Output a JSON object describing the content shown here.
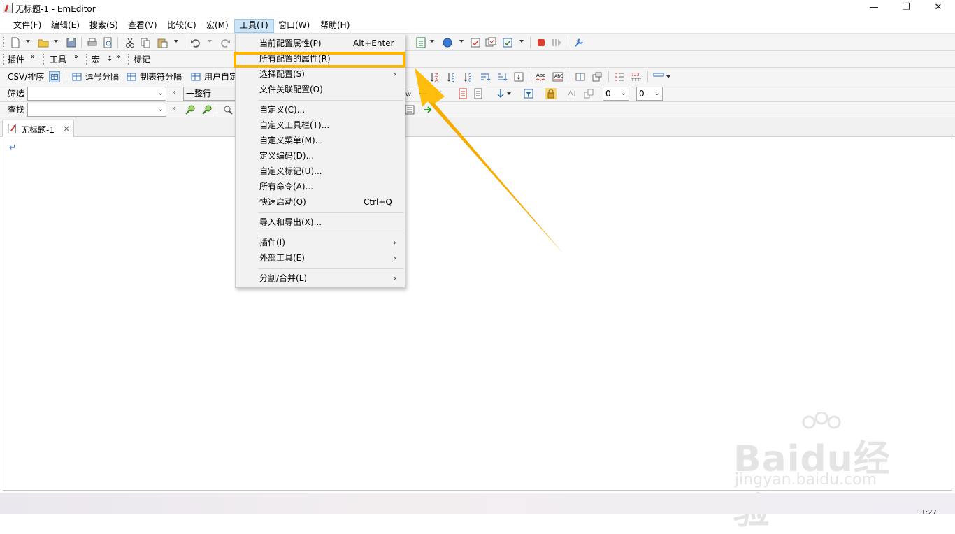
{
  "window": {
    "title": "无标题-1 - EmEditor",
    "minimize": "—",
    "restore": "❐",
    "close": "✕"
  },
  "menubar": {
    "items": [
      {
        "label": "文件(F)"
      },
      {
        "label": "编辑(E)"
      },
      {
        "label": "搜索(S)"
      },
      {
        "label": "查看(V)"
      },
      {
        "label": "比较(C)"
      },
      {
        "label": "宏(M)"
      },
      {
        "label": "工具(T)"
      },
      {
        "label": "窗口(W)"
      },
      {
        "label": "帮助(H)"
      }
    ]
  },
  "toolbar2": {
    "plugin": "插件",
    "tools": "工具",
    "macro": "宏",
    "macro_extra": "↕",
    "marks": "标记",
    "chev": "»"
  },
  "csv_bar": {
    "csv_sort": "CSV/排序",
    "comma": "逗号分隔",
    "tab": "制表符分隔",
    "user": "用户自定"
  },
  "filter_bar": {
    "label": "筛选",
    "mode": "一整行",
    "num1": "0",
    "num2": "0"
  },
  "find_bar": {
    "label": "查找"
  },
  "tabs": [
    {
      "label": "无标题-1",
      "close": "×"
    }
  ],
  "editor": {
    "eol_marker": "↵"
  },
  "dropdown": {
    "items": [
      {
        "label": "当前配置属性(P)",
        "shortcut": "Alt+Enter"
      },
      {
        "label": "所有配置的属性(R)",
        "shortcut": ""
      },
      {
        "label": "选择配置(S)",
        "submenu": "›"
      },
      {
        "label": "文件关联配置(O)",
        "shortcut": ""
      },
      {
        "label": "自定义(C)...",
        "shortcut": ""
      },
      {
        "label": "自定义工具栏(T)...",
        "shortcut": ""
      },
      {
        "label": "自定义菜单(M)...",
        "shortcut": ""
      },
      {
        "label": "定义编码(D)...",
        "shortcut": ""
      },
      {
        "label": "自定义标记(U)...",
        "shortcut": ""
      },
      {
        "label": "所有命令(A)...",
        "shortcut": ""
      },
      {
        "label": "快速启动(Q)",
        "shortcut": "Ctrl+Q"
      },
      {
        "label": "导入和导出(X)...",
        "shortcut": ""
      },
      {
        "label": "插件(I)",
        "submenu": "›"
      },
      {
        "label": "外部工具(E)",
        "submenu": "›"
      },
      {
        "label": "分割/合并(L)",
        "submenu": "›"
      }
    ]
  },
  "colors": {
    "highlight": "#ffb400",
    "menu_active": "#cce4f7"
  },
  "watermark": {
    "brand": "Baidu经验",
    "url": "jingyan.baidu.com"
  },
  "statusbar": {
    "clock": "11:27"
  }
}
